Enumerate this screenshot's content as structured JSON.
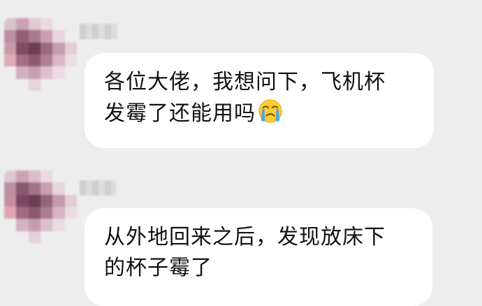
{
  "messages": [
    {
      "text_line1": "各位大佬，我想问下，飞机杯",
      "text_line2": "发霉了还能用吗",
      "emoji": "crying-face-emoji"
    },
    {
      "text_line1": "从外地回来之后，发现放床下",
      "text_line2": "的杯子霉了"
    }
  ],
  "colors": {
    "background": "#ededed",
    "bubble": "#ffffff",
    "text": "#111111",
    "emoji_face": "#ffcc33",
    "emoji_tears": "#4aa8e8"
  }
}
